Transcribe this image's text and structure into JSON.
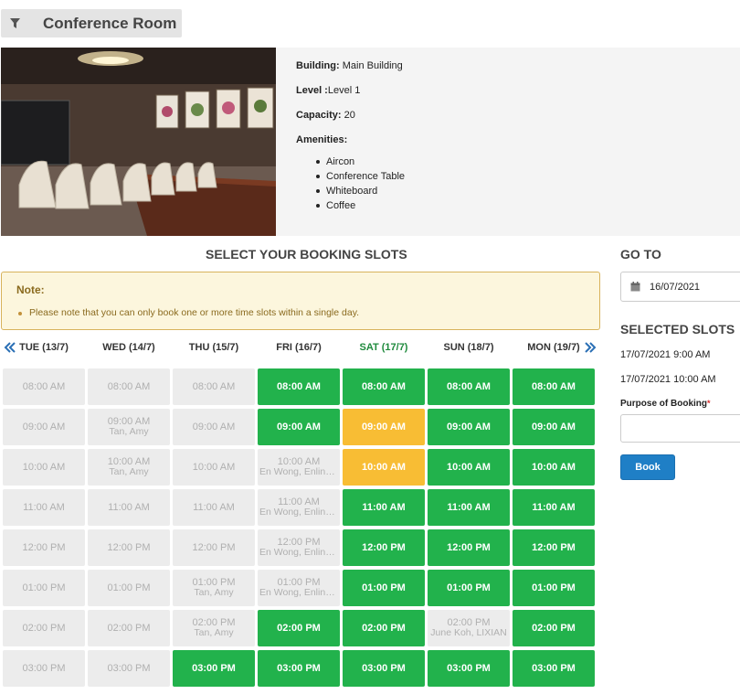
{
  "header": {
    "title": "Conference Room",
    "filter_icon": "filter-icon"
  },
  "room": {
    "building_label": "Building:",
    "building": "Main Building",
    "level_label": "Level :",
    "level": "Level 1",
    "capacity_label": "Capacity:",
    "capacity": "20",
    "amenities_label": "Amenities:",
    "amenities": [
      "Aircon",
      "Conference Table",
      "Whiteboard",
      "Coffee"
    ]
  },
  "booking": {
    "title": "SELECT YOUR BOOKING SLOTS",
    "note_title": "Note:",
    "note_text": "Please note that you can only book one or more time slots within a single day.",
    "days": [
      {
        "label": "TUE (13/7)"
      },
      {
        "label": "WED (14/7)"
      },
      {
        "label": "THU (15/7)"
      },
      {
        "label": "FRI (16/7)"
      },
      {
        "label": "SAT (17/7)",
        "today": true
      },
      {
        "label": "SUN (18/7)"
      },
      {
        "label": "MON (19/7)"
      }
    ],
    "times": [
      "08:00 AM",
      "09:00 AM",
      "10:00 AM",
      "11:00 AM",
      "12:00 PM",
      "01:00 PM",
      "02:00 PM",
      "03:00 PM"
    ],
    "grid": [
      [
        {
          "s": "past"
        },
        {
          "s": "past"
        },
        {
          "s": "past"
        },
        {
          "s": "past"
        },
        {
          "s": "past"
        },
        {
          "s": "past"
        },
        {
          "s": "past"
        },
        {
          "s": "past"
        }
      ],
      [
        {
          "s": "past"
        },
        {
          "s": "booked",
          "who": "Tan, Amy"
        },
        {
          "s": "booked",
          "who": "Tan, Amy"
        },
        {
          "s": "past"
        },
        {
          "s": "past"
        },
        {
          "s": "past"
        },
        {
          "s": "past"
        },
        {
          "s": "past"
        }
      ],
      [
        {
          "s": "past"
        },
        {
          "s": "past"
        },
        {
          "s": "past"
        },
        {
          "s": "past"
        },
        {
          "s": "past"
        },
        {
          "s": "booked",
          "who": "Tan, Amy"
        },
        {
          "s": "booked",
          "who": "Tan, Amy"
        },
        {
          "s": "avail"
        }
      ],
      [
        {
          "s": "avail"
        },
        {
          "s": "avail"
        },
        {
          "s": "booked",
          "who": "En Wong, Enling..."
        },
        {
          "s": "booked",
          "who": "En Wong, Enling..."
        },
        {
          "s": "booked",
          "who": "En Wong, Enling..."
        },
        {
          "s": "booked",
          "who": "En Wong, Enling..."
        },
        {
          "s": "avail"
        },
        {
          "s": "avail"
        }
      ],
      [
        {
          "s": "avail"
        },
        {
          "s": "picked"
        },
        {
          "s": "picked"
        },
        {
          "s": "avail"
        },
        {
          "s": "avail"
        },
        {
          "s": "avail"
        },
        {
          "s": "avail"
        },
        {
          "s": "avail"
        }
      ],
      [
        {
          "s": "avail"
        },
        {
          "s": "avail"
        },
        {
          "s": "avail"
        },
        {
          "s": "avail"
        },
        {
          "s": "avail"
        },
        {
          "s": "avail"
        },
        {
          "s": "booked",
          "who": "June Koh, LIXIAN"
        },
        {
          "s": "avail"
        }
      ],
      [
        {
          "s": "avail"
        },
        {
          "s": "avail"
        },
        {
          "s": "avail"
        },
        {
          "s": "avail"
        },
        {
          "s": "avail"
        },
        {
          "s": "avail"
        },
        {
          "s": "avail"
        },
        {
          "s": "avail"
        }
      ]
    ]
  },
  "sidebar": {
    "goto_title": "GO TO",
    "goto_date": "16/07/2021",
    "selected_title": "SELECTED SLOTS",
    "selected": [
      "17/07/2021 9:00 AM",
      "17/07/2021 10:00 AM"
    ],
    "purpose_label": "Purpose of Booking",
    "purpose_required": "*",
    "purpose_value": "",
    "book_label": "Book"
  },
  "colors": {
    "available": "#22b24c",
    "selected": "#f8bd34",
    "unavailable": "#ececec",
    "book": "#1f7fc6",
    "today": "#1e8a3c"
  }
}
